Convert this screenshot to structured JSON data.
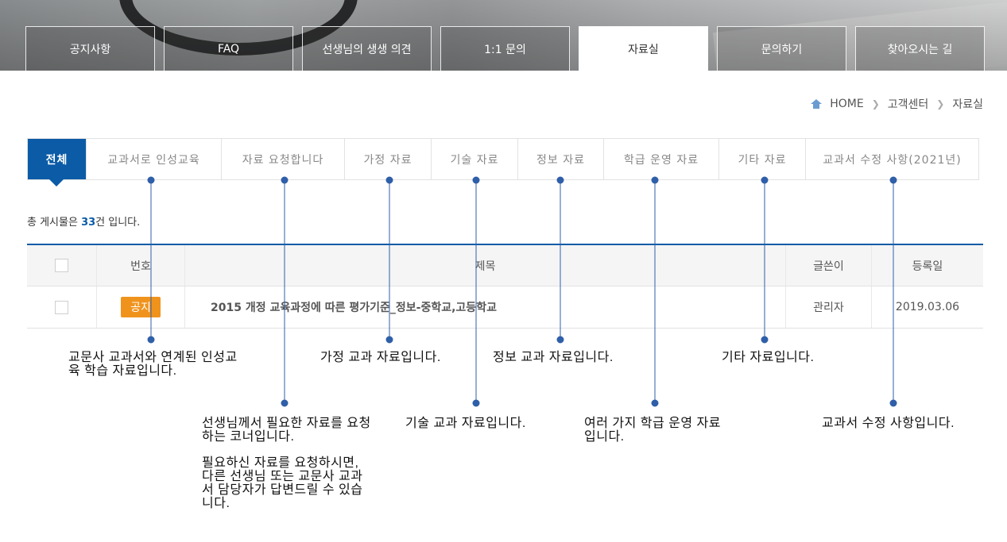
{
  "top_tabs": [
    {
      "label": "공지사항"
    },
    {
      "label": "FAQ"
    },
    {
      "label": "선생님의 생생 의견"
    },
    {
      "label": "1:1 문의"
    },
    {
      "label": "자료실"
    },
    {
      "label": "문의하기"
    },
    {
      "label": "찾아오시는 길"
    }
  ],
  "breadcrumb": {
    "home": "HOME",
    "level1": "고객센터",
    "level2": "자료실"
  },
  "category_tabs": [
    {
      "label": "전체"
    },
    {
      "label": "교과서로 인성교육"
    },
    {
      "label": "자료 요청합니다"
    },
    {
      "label": "가정 자료"
    },
    {
      "label": "기술 자료"
    },
    {
      "label": "정보 자료"
    },
    {
      "label": "학급 운영 자료"
    },
    {
      "label": "기타 자료"
    },
    {
      "label": "교과서 수정 사항(2021년)"
    }
  ],
  "total": {
    "prefix": "총 게시물은 ",
    "count": "33",
    "suffix": "건 입니다."
  },
  "table": {
    "headers": {
      "number": "번호",
      "title": "제목",
      "writer": "글쓴이",
      "date": "등록일"
    },
    "rows": [
      {
        "badge": "공지",
        "title": "2015 개정 교육과정에 따른 평가기준_정보-중학교,고등학교",
        "writer": "관리자",
        "date": "2019.03.06"
      }
    ]
  },
  "annotations": {
    "insung": "교문사 교과서와 연계된 인성교육 학습 자료입니다.",
    "request_1": "선생님께서 필요한 자료를 요청하는 코너입니다.",
    "request_2": "필요하신 자료를 요청하시면, 다른 선생님 또는 교문사 교과서 담당자가 답변드릴 수 있습니다.",
    "gajeong": "가정 교과 자료입니다.",
    "gisul": "기술 교과 자료입니다.",
    "jeongbo": "정보 교과 자료입니다.",
    "hakgeup": "여러 가지 학급 운영 자료입니다.",
    "gita": "기타 자료입니다.",
    "sujeong": "교과서 수정 사항입니다."
  },
  "colors": {
    "accent": "#0b5ba7",
    "badge": "#f0931d",
    "annotation_line": "#2f5fa8"
  }
}
